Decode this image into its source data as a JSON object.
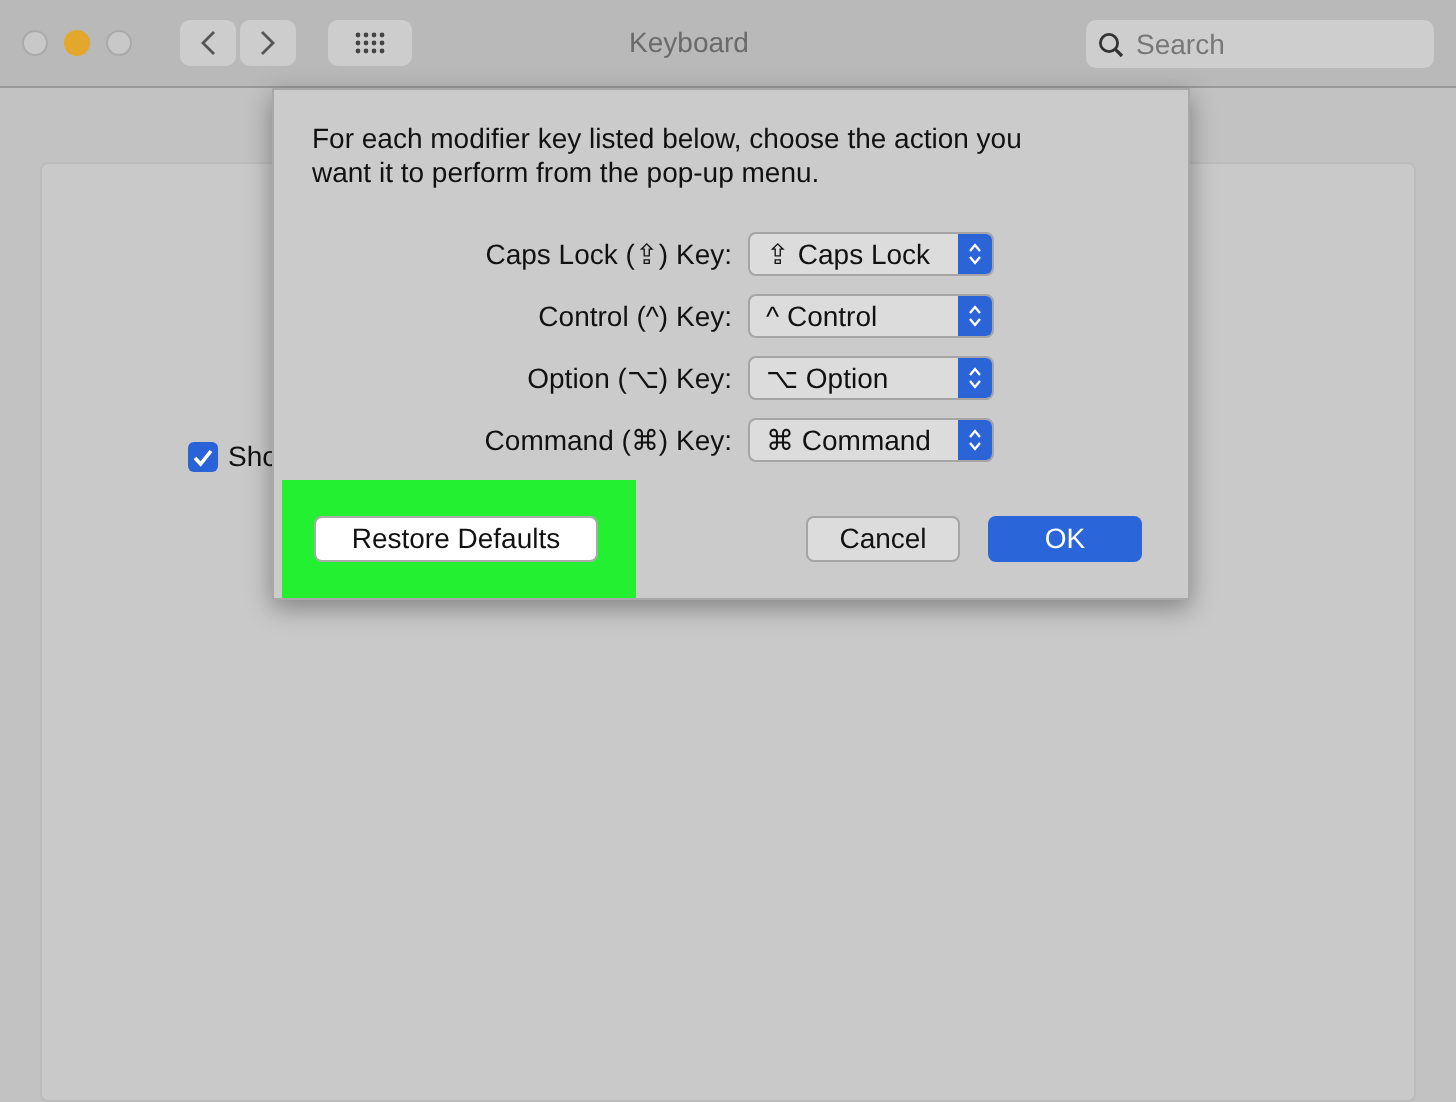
{
  "window": {
    "title": "Keyboard",
    "search": {
      "placeholder": "Search"
    }
  },
  "background": {
    "checkbox": {
      "label": "Sho",
      "checked": true
    }
  },
  "sheet": {
    "description": "For each modifier key listed below, choose the action you want it to perform from the pop-up menu.",
    "rows": [
      {
        "label": "Caps Lock (⇪) Key:",
        "value": "⇪ Caps Lock"
      },
      {
        "label": "Control (^) Key:",
        "value": "^ Control"
      },
      {
        "label": "Option (⌥) Key:",
        "value": "⌥ Option"
      },
      {
        "label": "Command (⌘) Key:",
        "value": "⌘ Command"
      }
    ],
    "restore_button": {
      "label": "Restore Defaults",
      "highlighted": true
    },
    "buttons": [
      {
        "label": "Cancel",
        "kind": "secondary"
      },
      {
        "label": "OK",
        "kind": "primary"
      }
    ]
  }
}
